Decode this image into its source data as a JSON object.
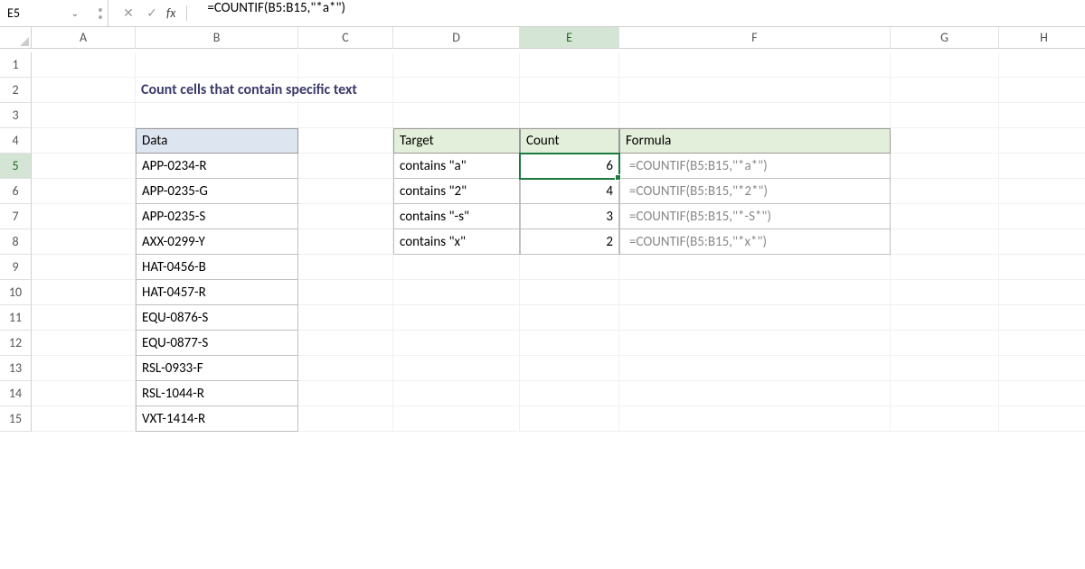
{
  "namebox": "E5",
  "formula": "=COUNTIF(B5:B15,\"*a*\")",
  "columns": [
    "A",
    "B",
    "C",
    "D",
    "E",
    "F",
    "G",
    "H"
  ],
  "rows": [
    "1",
    "2",
    "3",
    "4",
    "5",
    "6",
    "7",
    "8",
    "9",
    "10",
    "11",
    "12",
    "13",
    "14",
    "15"
  ],
  "activeCol": "E",
  "activeRow": "5",
  "title": "Count cells that contain specific text",
  "dataHeader": "Data",
  "dataCol": [
    "APP-0234-R",
    "APP-0235-G",
    "APP-0235-S",
    "AXX-0299-Y",
    "HAT-0456-B",
    "HAT-0457-R",
    "EQU-0876-S",
    "EQU-0877-S",
    "RSL-0933-F",
    "RSL-1044-R",
    "VXT-1414-R"
  ],
  "targetHeader": "Target",
  "countHeader": "Count",
  "formulaHeader": "Formula",
  "resultRows": [
    {
      "target": "contains \"a\"",
      "count": "6",
      "formula": "=COUNTIF(B5:B15,\"*a*\")"
    },
    {
      "target": "contains \"2\"",
      "count": "4",
      "formula": "=COUNTIF(B5:B15,\"*2*\")"
    },
    {
      "target": "contains \"-s\"",
      "count": "3",
      "formula": "=COUNTIF(B5:B15,\"*-S*\")"
    },
    {
      "target": "contains \"x\"",
      "count": "2",
      "formula": "=COUNTIF(B5:B15,\"*x*\")"
    }
  ]
}
